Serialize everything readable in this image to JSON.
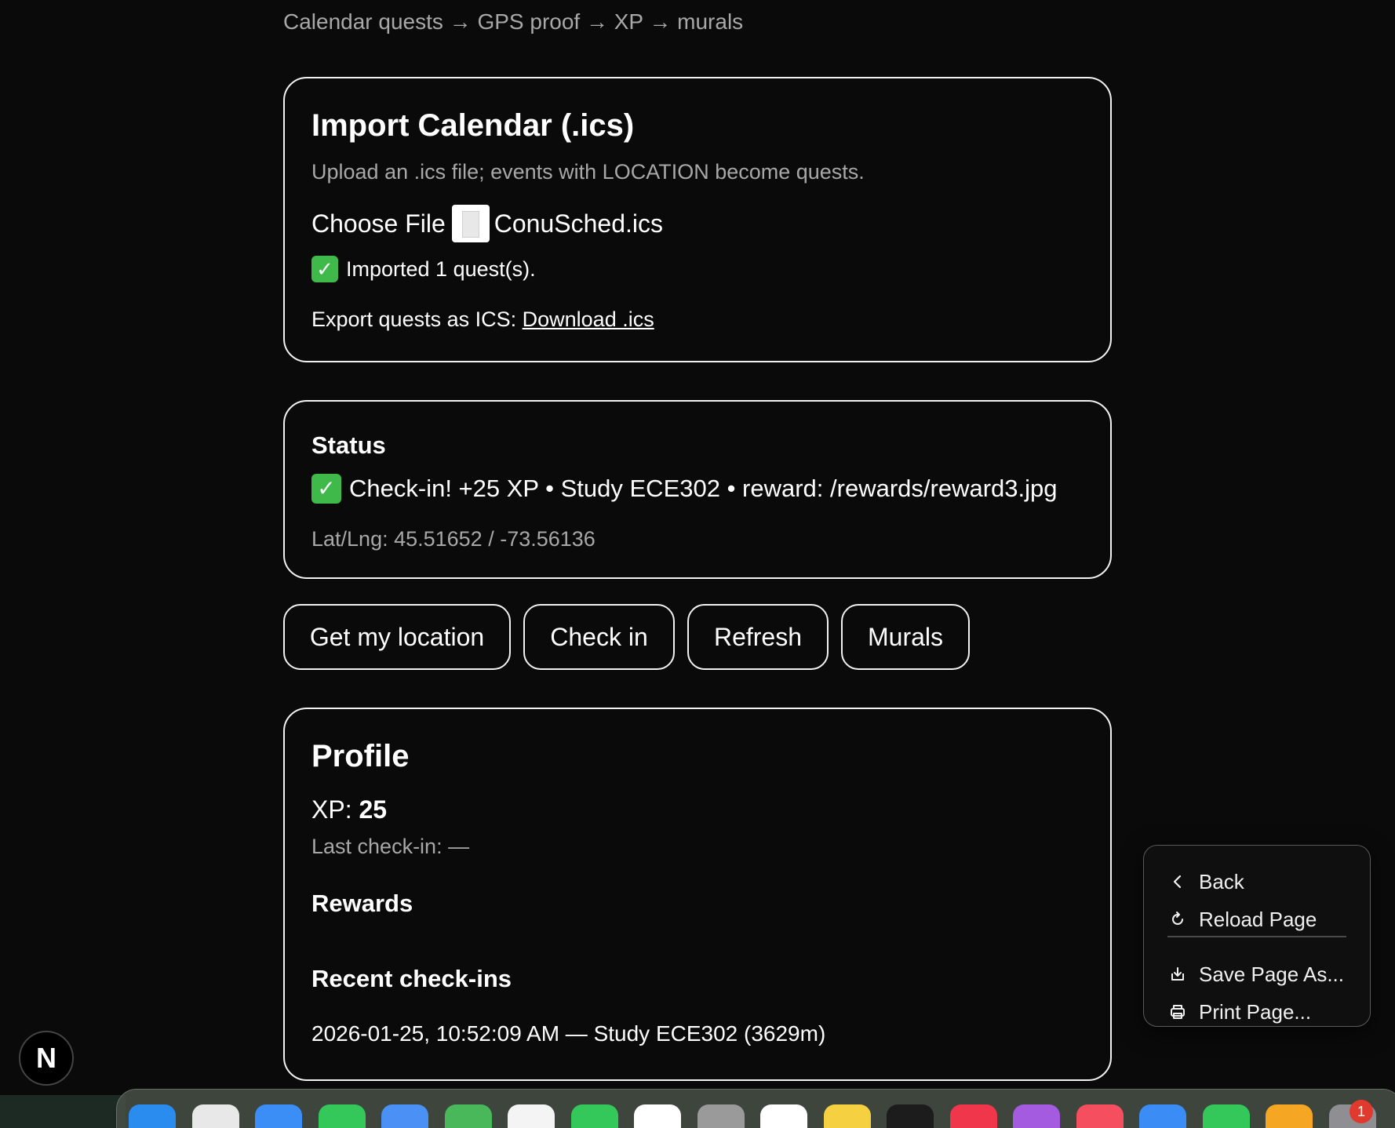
{
  "breadcrumb": "Calendar quests → GPS proof → XP → murals",
  "import_card": {
    "title": "Import Calendar (.ics)",
    "subtitle": "Upload an .ics file; events with LOCATION become quests.",
    "choose_file_label": "Choose File",
    "file_name": "ConuSched.ics",
    "imported_message": "Imported 1 quest(s).",
    "export_label": "Export quests as ICS:",
    "download_link": "Download .ics"
  },
  "status_card": {
    "title": "Status",
    "message": "Check-in! +25 XP • Study ECE302 • reward: /rewards/reward3.jpg",
    "latlng": "Lat/Lng: 45.51652 / -73.56136"
  },
  "actions": {
    "get_location": "Get my location",
    "check_in": "Check in",
    "refresh": "Refresh",
    "murals": "Murals"
  },
  "profile_card": {
    "title": "Profile",
    "xp_label": "XP:",
    "xp_value": "25",
    "last_checkin": "Last check-in: —",
    "rewards_heading": "Rewards",
    "recent_heading": "Recent check-ins",
    "recent_items": [
      "2026-01-25, 10:52:09 AM — Study ECE302 (3629m)"
    ]
  },
  "context_menu": {
    "back": "Back",
    "reload": "Reload Page",
    "save": "Save Page As...",
    "print": "Print Page..."
  },
  "nextjs_badge": "N",
  "dock": {
    "badge_count": "1",
    "icons": [
      "finder-icon",
      "launchpad-icon",
      "safari-icon",
      "messages-icon",
      "mail-icon",
      "maps-icon",
      "photos-icon",
      "facetime-icon",
      "calendar-icon",
      "contacts-icon",
      "reminders-icon",
      "notes-icon",
      "tv-icon",
      "music-icon",
      "podcasts-icon",
      "news-icon",
      "keynote-icon",
      "numbers-icon",
      "pages-icon",
      "settings-icon"
    ],
    "colors": [
      "#2b8cf0",
      "#e8e8e8",
      "#3a8ef5",
      "#34c759",
      "#4a90f5",
      "#48b85a",
      "#f4f4f4",
      "#34c759",
      "#ffffff",
      "#9a9a9a",
      "#ffffff",
      "#f5d142",
      "#1c1c1c",
      "#f0364a",
      "#a45be0",
      "#f54e5e",
      "#3b8cf5",
      "#34c759",
      "#f5a623",
      "#8e8e93"
    ]
  }
}
